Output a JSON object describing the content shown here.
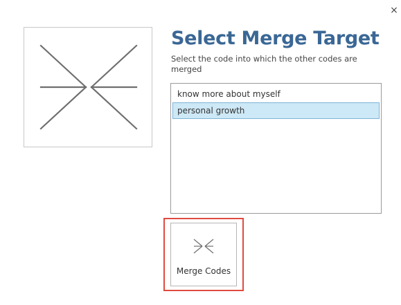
{
  "dialog": {
    "close_glyph": "×",
    "title": "Select Merge Target",
    "subtitle": "Select the code into which the other codes are merged",
    "illustration_icon": "merge-arrows-icon"
  },
  "code_list": {
    "items": [
      {
        "label": "know more about myself",
        "selected": false
      },
      {
        "label": "personal growth",
        "selected": true
      }
    ]
  },
  "merge_button": {
    "label": "Merge Codes",
    "icon": "merge-arrows-icon"
  },
  "colors": {
    "title": "#3a6795",
    "selection_bg": "#cde8f6",
    "selection_border": "#7eb4d8",
    "highlight_border": "#e04a3f"
  }
}
